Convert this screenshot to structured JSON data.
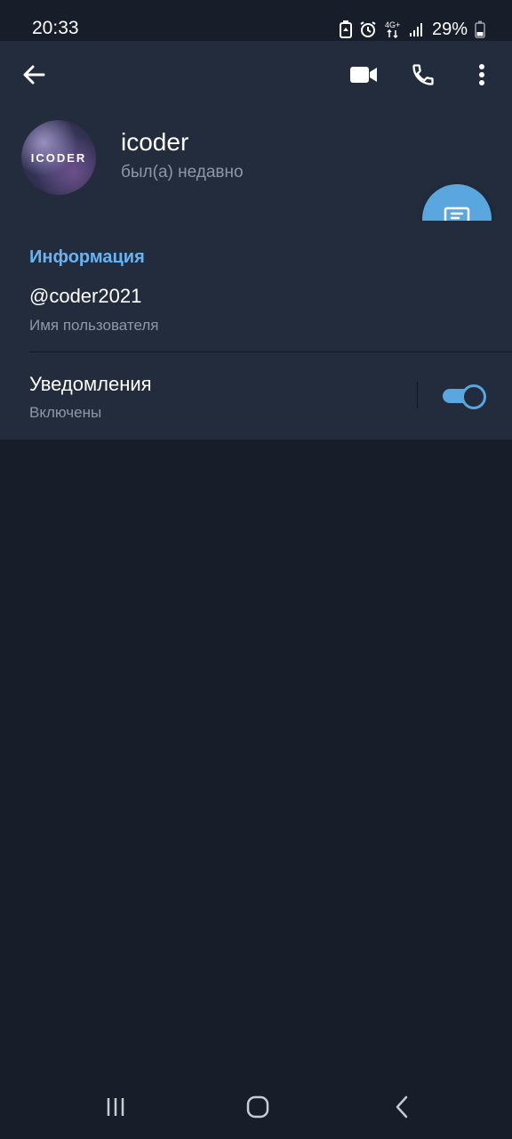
{
  "status_bar": {
    "time": "20:33",
    "network": "4G+",
    "battery_percent": "29%",
    "icons": [
      "battery-saver-icon",
      "alarm-icon",
      "network-4g-icon",
      "signal-icon",
      "battery-icon"
    ]
  },
  "header": {
    "back_icon": "arrow-left-icon",
    "actions": [
      "video-call-icon",
      "phone-icon",
      "more-vert-icon"
    ],
    "avatar_text": "ICODER",
    "name": "icoder",
    "status": "был(а) недавно",
    "fab_icon": "message-icon"
  },
  "info": {
    "title": "Информация",
    "username": "@coder2021",
    "username_label": "Имя пользователя",
    "notifications_label": "Уведомления",
    "notifications_status": "Включены",
    "notifications_enabled": true
  },
  "nav_bar": {
    "buttons": [
      "recent-apps-icon",
      "home-icon",
      "back-icon"
    ]
  },
  "colors": {
    "background": "#181e29",
    "surface": "#222c3c",
    "accent": "#5aa7e0",
    "section_title": "#6ab3f3",
    "secondary_text": "#8c98a8"
  }
}
